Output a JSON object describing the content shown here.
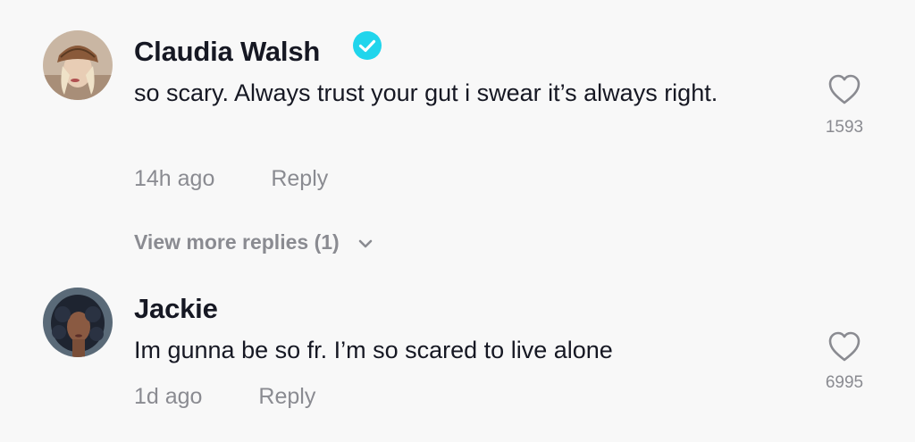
{
  "comments": [
    {
      "username": "Claudia Walsh",
      "verified": true,
      "text": "so scary. Always trust your gut i swear it’s always right.",
      "time": "14h ago",
      "reply_label": "Reply",
      "likes": "1593",
      "view_more_label": "View more replies (1)"
    },
    {
      "username": "Jackie",
      "verified": false,
      "text": "Im gunna be so fr. I’m so scared to live alone",
      "time": "1d ago",
      "reply_label": "Reply",
      "likes": "6995"
    }
  ],
  "colors": {
    "background": "#f8f8f8",
    "primary_text": "#161823",
    "secondary_text": "#8a8b91",
    "verified_badge": "#20d5ec"
  }
}
